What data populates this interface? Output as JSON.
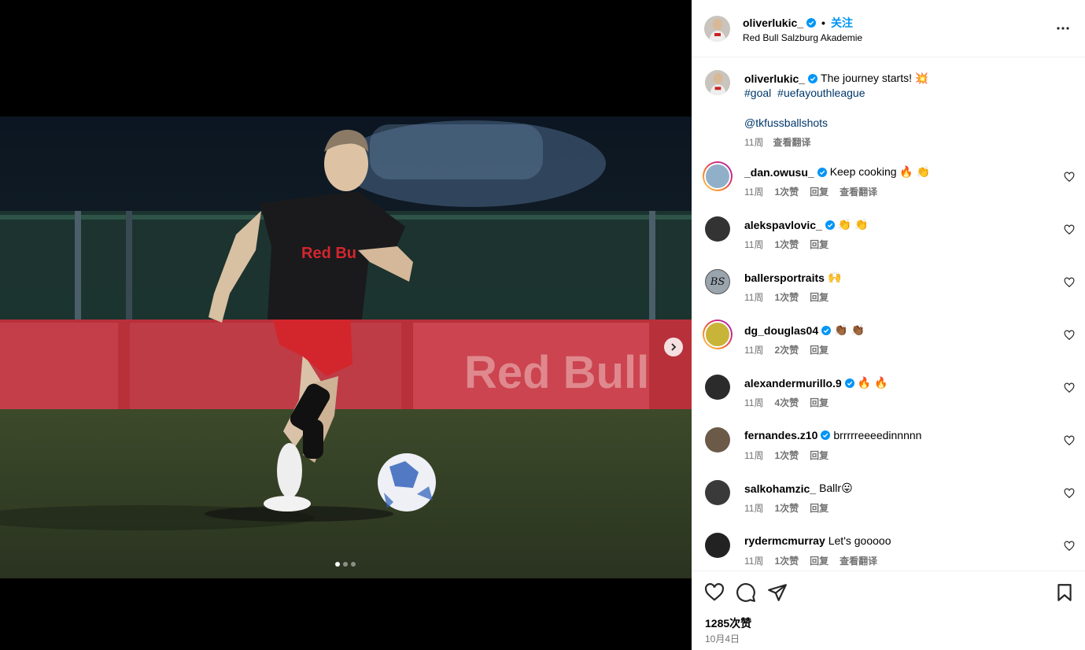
{
  "post": {
    "author": "oliverlukic_",
    "follow_label": "关注",
    "separator": "•",
    "location": "Red Bull Salzburg Akademie"
  },
  "caption": {
    "username": "oliverlukic_",
    "text": "The journey starts! 💥",
    "hashtags": [
      "#goal",
      "#uefayouthleague"
    ],
    "mention": "@tkfussballshots",
    "time": "11周",
    "translate": "查看翻译"
  },
  "comments": [
    {
      "username": "_dan.owusu_",
      "verified": true,
      "text": "Keep cooking 🔥 👏",
      "time": "11周",
      "likes": "1次赞",
      "reply": "回复",
      "translate": "查看翻译"
    },
    {
      "username": "alekspavlovic_",
      "verified": true,
      "text": "👏 👏",
      "time": "11周",
      "likes": "1次赞",
      "reply": "回复",
      "translate": ""
    },
    {
      "username": "ballersportraits",
      "verified": false,
      "text": "🙌",
      "time": "11周",
      "likes": "1次赞",
      "reply": "回复",
      "translate": "",
      "avatar_text": "BS"
    },
    {
      "username": "dg_douglas04",
      "verified": true,
      "text": "👏🏾 👏🏾",
      "time": "11周",
      "likes": "2次赞",
      "reply": "回复",
      "translate": ""
    },
    {
      "username": "alexandermurillo.9",
      "verified": true,
      "text": "🔥 🔥",
      "time": "11周",
      "likes": "4次赞",
      "reply": "回复",
      "translate": ""
    },
    {
      "username": "fernandes.z10",
      "verified": true,
      "text": "brrrrreeeedinnnnn",
      "time": "11周",
      "likes": "1次赞",
      "reply": "回复",
      "translate": ""
    },
    {
      "username": "salkohamzic_",
      "verified": false,
      "text": "Ballr😛",
      "time": "11周",
      "likes": "1次赞",
      "reply": "回复",
      "translate": ""
    },
    {
      "username": "rydermcmurray",
      "verified": false,
      "text": "Let's gooooo",
      "time": "11周",
      "likes": "1次赞",
      "reply": "回复",
      "translate": "查看翻译"
    }
  ],
  "footer": {
    "likes": "1285次赞",
    "date": "10月4日"
  },
  "colors": {
    "accent": "#0095f6",
    "link": "#00376b",
    "muted": "#737373",
    "verified": "#0095f6"
  },
  "carousel": {
    "count": 3,
    "active": 0
  }
}
